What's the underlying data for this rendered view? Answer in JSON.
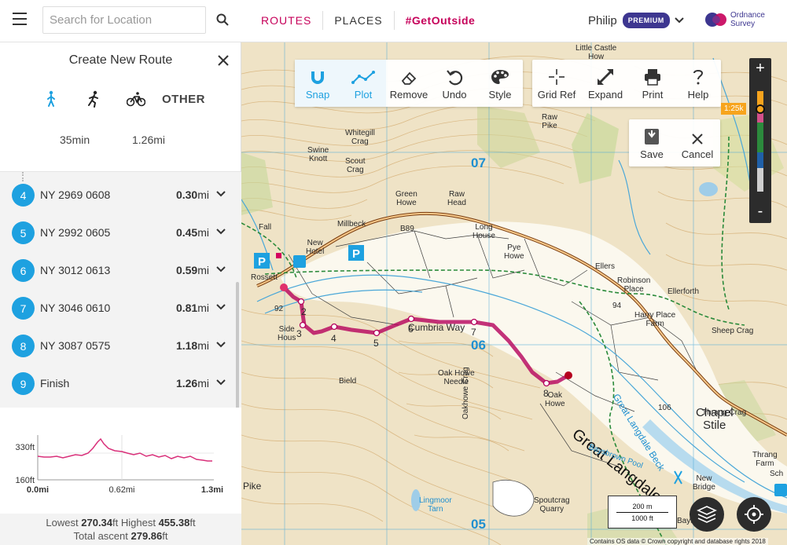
{
  "header": {
    "search_placeholder": "Search for Location",
    "nav": [
      {
        "label": "ROUTES"
      },
      {
        "label": "PLACES"
      },
      {
        "label": "#GetOutside"
      }
    ],
    "user_name": "Philip",
    "badge": "PREMIUM",
    "logo_text_1": "Ordnance",
    "logo_text_2": "Survey"
  },
  "sidebar": {
    "title": "Create New Route",
    "mode_other": "OTHER",
    "time_value": "35",
    "time_unit": "min",
    "distance_value": "1.26",
    "distance_unit": "mi",
    "waypoints": [
      {
        "num": "4",
        "ref": "NY 2969 0608",
        "dist": "0.30",
        "unit": "mi"
      },
      {
        "num": "5",
        "ref": "NY 2992 0605",
        "dist": "0.45",
        "unit": "mi"
      },
      {
        "num": "6",
        "ref": "NY 3012 0613",
        "dist": "0.59",
        "unit": "mi"
      },
      {
        "num": "7",
        "ref": "NY 3046 0610",
        "dist": "0.81",
        "unit": "mi"
      },
      {
        "num": "8",
        "ref": "NY 3087 0575",
        "dist": "1.18",
        "unit": "mi"
      },
      {
        "num": "9",
        "ref": "Finish",
        "dist": "1.26",
        "unit": "mi"
      }
    ],
    "profile": {
      "y_top": "330ft",
      "y_bottom": "160ft",
      "x_start": "0.0mi",
      "x_mid": "0.62mi",
      "x_end": "1.3mi"
    },
    "summary": {
      "lowest_label": "Lowest",
      "lowest_value": "270.34",
      "highest_label": "Highest",
      "highest_value": "455.38",
      "ascent_label": "Total ascent",
      "ascent_value": "279.86",
      "unit": "ft"
    }
  },
  "toolbar": {
    "snap": "Snap",
    "plot": "Plot",
    "remove": "Remove",
    "undo": "Undo",
    "style": "Style",
    "grid_ref": "Grid Ref",
    "expand": "Expand",
    "print": "Print",
    "help": "Help",
    "save": "Save",
    "cancel": "Cancel"
  },
  "map": {
    "zoom_in": "+",
    "zoom_out": "-",
    "scale_label": "1:25k",
    "scale_m": "200 m",
    "scale_ft": "1000 ft",
    "copyright": "Contains OS data © Crown copyright and database rights 2018",
    "grid_labels": [
      "07",
      "06",
      "05"
    ],
    "place_labels": {
      "little_castle": "Little Castle\nHow",
      "raw_pike": "Raw\nPike",
      "whitegill": "Whitegill\nCrag",
      "swine_knott": "Swine\nKnott",
      "scout_crag": "Scout\nCrag",
      "green_howe": "Green\nHowe",
      "raw_head": "Raw\nHead",
      "millbeck": "Millbeck",
      "b89": "B89",
      "long_house": "Long\nHouse",
      "pye_howe": "Pye\nHowe",
      "new_hotel": "New\nHotel",
      "ellers": "Ellers",
      "robinson_place": "Robinson\nPlace",
      "ellerforth": "Ellerforth",
      "harry_place": "Harry Place\nFarm",
      "sheep_crag": "Sheep Crag",
      "rossett": "Rossett",
      "fall": "Fall",
      "side_house": "Side\nHous",
      "cumbria_way": "Cumbria Way",
      "oak_howe_needle": "Oak Howe\nNeedle",
      "oak_howe": "Oak\nHowe",
      "bield": "Bield",
      "oakhowe_crag": "Oakhowe Crag",
      "great_langdale": "Great Langdale",
      "great_langdale_beck": "Great Langdale Beck",
      "thrang_crag": "Thrang Crag",
      "chapel_stile": "Chapel\nStile",
      "baysbrown_pool": "Baysbrown Pool",
      "lingmoor_tarn": "Lingmoor\nTarn",
      "spoutcrag": "Spoutcrag\nQuarry",
      "pike": "Pike",
      "new_bridge": "New\nBridge",
      "thrang_farm": "Thrang\nFarm",
      "baysbrown": "Baysbrown",
      "n92": "92",
      "n94": "94",
      "n106": "106",
      "fell_foot": "Sch"
    },
    "route_marks": [
      "2",
      "3",
      "4",
      "5",
      "6",
      "7",
      "8"
    ]
  }
}
